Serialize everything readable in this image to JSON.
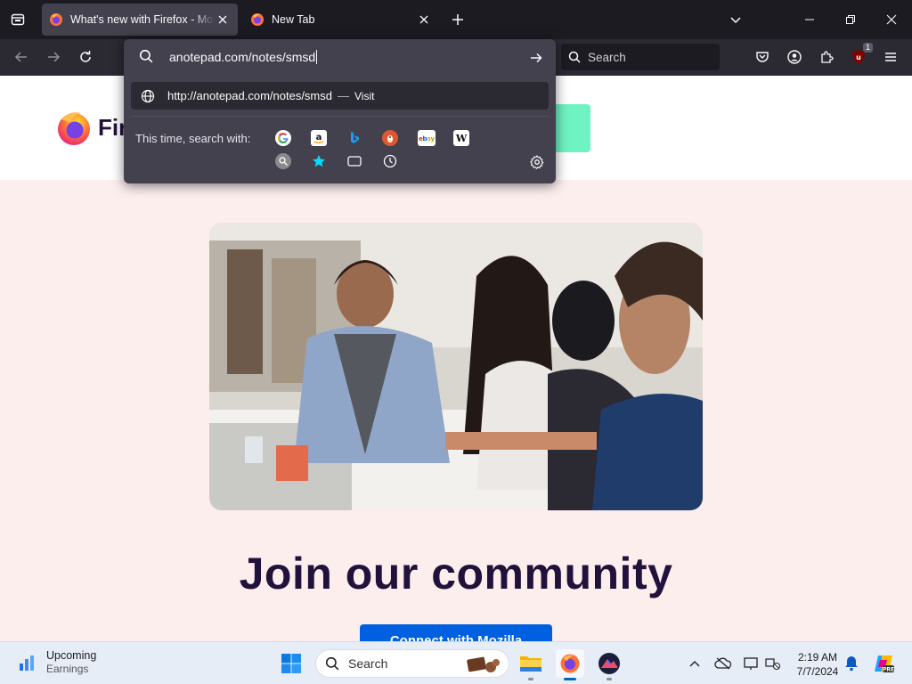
{
  "tabs": [
    {
      "title": "What's new with Firefox - More",
      "active": true
    },
    {
      "title": "New Tab",
      "active": false
    }
  ],
  "toolbar": {
    "search_placeholder": "Search",
    "extension_badge": "1"
  },
  "urlbar": {
    "value": "anotepad.com/notes/smsd",
    "suggestion": {
      "url": "http://anotepad.com/notes/smsd",
      "separator": "—",
      "action": "Visit"
    },
    "search_with_label": "This time, search with:",
    "engines": [
      "google",
      "amazon",
      "bing",
      "duckduckgo",
      "ebay",
      "wikipedia"
    ],
    "modes": [
      "search-engine",
      "bookmarks",
      "tabs",
      "history"
    ]
  },
  "page": {
    "brand": "Firefox",
    "heading": "Join our community",
    "cta": "Connect with Mozilla"
  },
  "taskbar": {
    "widget_title": "Upcoming",
    "widget_subtitle": "Earnings",
    "search_label": "Search",
    "time": "2:19 AM",
    "date": "7/7/2024"
  },
  "colors": {
    "accent": "#0060df",
    "page_bg": "#fdeeee",
    "header_cta": "#6ff3c3",
    "heading": "#20123a"
  }
}
